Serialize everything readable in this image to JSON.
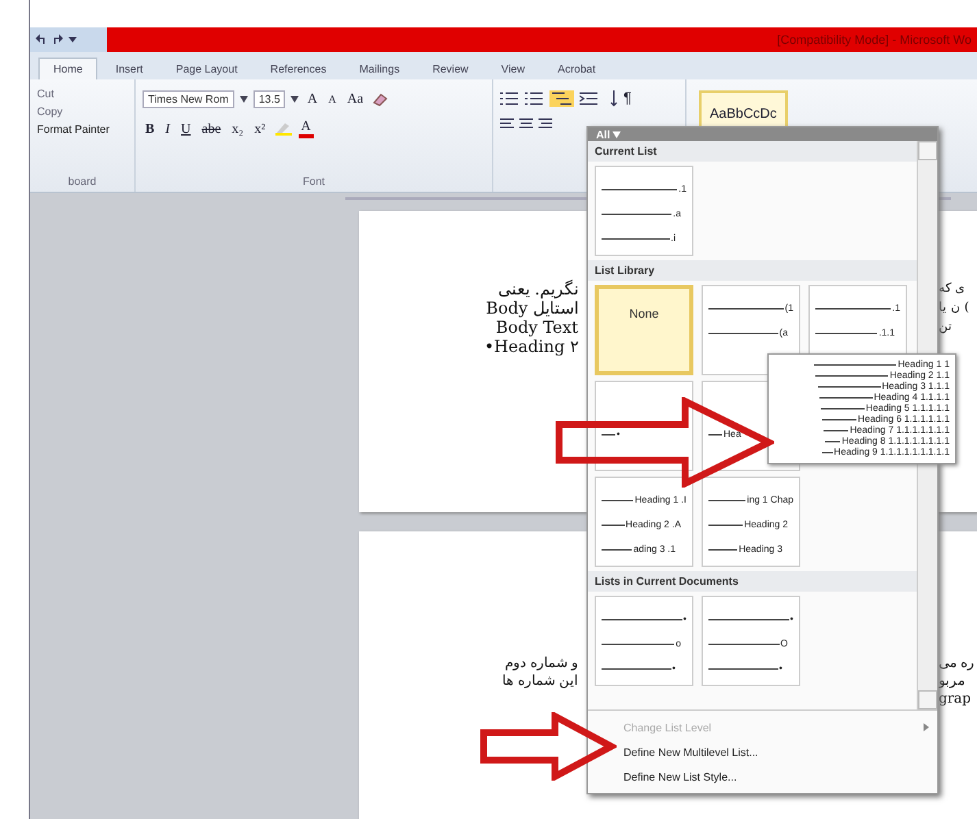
{
  "title_bar": {
    "title": "[Compatibility Mode] - Microsoft Wo"
  },
  "tabs": [
    {
      "label": "Home",
      "selected": true
    },
    {
      "label": "Insert",
      "selected": false
    },
    {
      "label": "Page Layout",
      "selected": false
    },
    {
      "label": "References",
      "selected": false
    },
    {
      "label": "Mailings",
      "selected": false
    },
    {
      "label": "Review",
      "selected": false
    },
    {
      "label": "View",
      "selected": false
    },
    {
      "label": "Acrobat",
      "selected": false
    }
  ],
  "clipboard": {
    "items": [
      "Cut",
      "Copy",
      "Format Painter"
    ],
    "group_label": "board"
  },
  "font": {
    "name": "Times New Rom",
    "size": "13.5",
    "grow": "A",
    "shrink": "A",
    "case": "Aa",
    "format_buttons": [
      "B",
      "I",
      "U",
      "abe",
      "x₂",
      "x²"
    ],
    "color_button": "A",
    "group_label": "Font"
  },
  "paragraph": {
    "pilcrow": "¶"
  },
  "styles": {
    "sample": "AaBbCcDc"
  },
  "document": {
    "pages": [
      {
        "left_lines": [
          "نگریم. یعنی",
          "Body استایل",
          "Body Text",
          "•Heading ۲"
        ],
        "right_lines": [
          "ی که",
          "ن یا (",
          "تن"
        ]
      },
      {
        "left_lines": [
          "و شماره دوم",
          "این شماره ها"
        ],
        "right_lines": [
          "ره می",
          "مربو",
          "grap"
        ]
      }
    ]
  },
  "list_menu": {
    "filter": "All",
    "sections": [
      {
        "title": "Current List",
        "rows": [
          [
            {
              "kind": "levels",
              "selected": false,
              "lines": [
                ".1",
                ".a",
                ".i"
              ]
            }
          ]
        ]
      },
      {
        "title": "List Library",
        "rows": [
          [
            {
              "kind": "none",
              "selected": true,
              "label": "None"
            },
            {
              "kind": "levels",
              "selected": false,
              "lines": [
                "(1",
                "(a"
              ]
            },
            {
              "kind": "levels",
              "selected": false,
              "lines": [
                ".1",
                ".1.1"
              ]
            }
          ],
          [
            {
              "kind": "levels",
              "selected": false,
              "lines": [
                "•"
              ]
            },
            {
              "kind": "levels",
              "selected": false,
              "lines": [
                "Hea"
              ]
            }
          ],
          [
            {
              "kind": "levels",
              "selected": false,
              "lines": [
                "Heading 1 .I",
                "Heading 2 .A",
                "ading 3 .1"
              ]
            },
            {
              "kind": "levels",
              "selected": false,
              "lines": [
                "ing 1 Chap",
                "Heading 2",
                "Heading 3"
              ]
            }
          ]
        ]
      },
      {
        "title": "Lists in Current Documents",
        "rows": [
          [
            {
              "kind": "levels",
              "selected": false,
              "lines": [
                "•",
                "o",
                "•"
              ]
            },
            {
              "kind": "levels",
              "selected": false,
              "lines": [
                "•",
                "O",
                "•"
              ]
            }
          ]
        ]
      }
    ],
    "commands": [
      {
        "label": "Change List Level",
        "disabled": true,
        "submenu": true
      },
      {
        "label": "Define New Multilevel List...",
        "disabled": false,
        "submenu": false
      },
      {
        "label": "Define New List Style...",
        "disabled": false,
        "submenu": false
      }
    ]
  },
  "tooltip": {
    "lines": [
      "Heading 1 1",
      "Heading 2 1.1",
      "Heading 3 1.1.1",
      "Heading 4 1.1.1.1",
      "Heading 5 1.1.1.1.1",
      "Heading 6 1.1.1.1.1.1",
      "Heading 7 1.1.1.1.1.1.1",
      "Heading 8 1.1.1.1.1.1.1.1",
      "Heading 9 1.1.1.1.1.1.1.1.1"
    ]
  }
}
